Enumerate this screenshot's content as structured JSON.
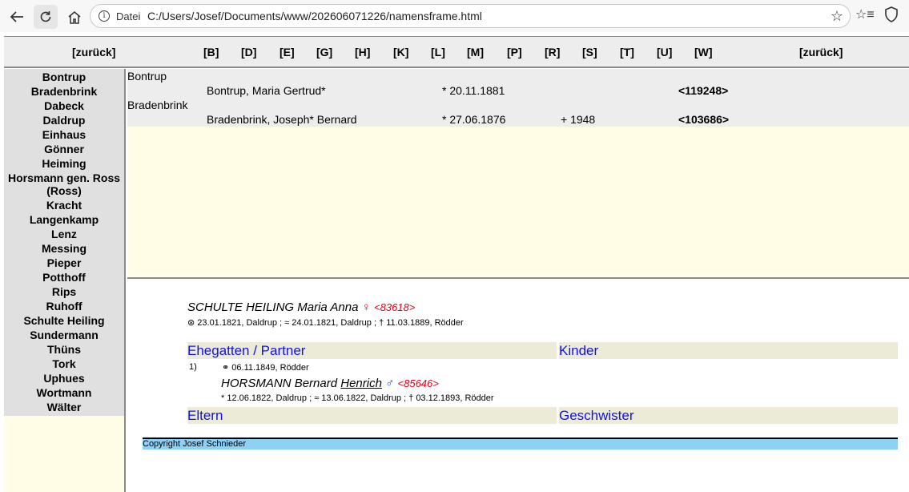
{
  "browser": {
    "info_label": "Datei",
    "url": "C:/Users/Josef/Documents/www/202606071226/namensframe.html"
  },
  "topnav": {
    "back_left": "[zurück]",
    "letters": [
      "[B]",
      "[D]",
      "[E]",
      "[G]",
      "[H]",
      "[K]",
      "[L]",
      "[M]",
      "[P]",
      "[R]",
      "[S]",
      "[T]",
      "[U]",
      "[W]"
    ],
    "back_right": "[zurück]"
  },
  "sidebar": {
    "names": [
      "Bontrup",
      "Bradenbrink",
      "Dabeck",
      "Daldrup",
      "Einhaus",
      "Gönner",
      "Heiming",
      "Horsmann gen. Ross (Ross)",
      "Kracht",
      "Langenkamp",
      "Lenz",
      "Messing",
      "Pieper",
      "Potthoff",
      "Rips",
      "Ruhoff",
      "Schulte Heiling",
      "Sundermann",
      "Thüns",
      "Tork",
      "Uphues",
      "Wortmann",
      "Wälter"
    ]
  },
  "results": {
    "groups": [
      {
        "family": "Bontrup",
        "name": "Bontrup, Maria Gertrud*",
        "birth": "* 20.11.1881",
        "death": "",
        "id": "<119248>"
      },
      {
        "family": "Bradenbrink",
        "name": "Bradenbrink, Joseph* Bernard",
        "birth": "* 27.06.1876",
        "death": "+ 1948",
        "id": "<103686>"
      }
    ]
  },
  "detail": {
    "person_surname": "SCHULTE HEILING",
    "person_given": "Maria Anna",
    "person_sex": "♀",
    "person_id": "<83618>",
    "person_dates": "⊛ 23.01.1821, Daldrup ; ≈ 24.01.1821, Daldrup ; † 11.03.1889, Rödder",
    "spouse_header": "Ehegatten / Partner",
    "children_header": "Kinder",
    "marriage_no": "1)",
    "marriage_info": "⚭ 06.11.1849, Rödder",
    "spouse_surname": "HORSMANN",
    "spouse_given1": "Bernard",
    "spouse_given2": "Henrich",
    "spouse_sex": "♂",
    "spouse_id": "<85646>",
    "spouse_dates": "* 12.06.1822, Daldrup ; ≈ 13.06.1822, Daldrup ; † 03.12.1893, Rödder",
    "parents_header": "Eltern",
    "siblings_header": "Geschwister",
    "copyright": "Copyright Josef Schnieder"
  },
  "colors": {
    "frame_bg": "#fffde6",
    "bar_bg": "#ebebd7",
    "bar_text": "#1212e6",
    "female": "#e0001b",
    "copyright_bg": "#8fd0f5"
  }
}
